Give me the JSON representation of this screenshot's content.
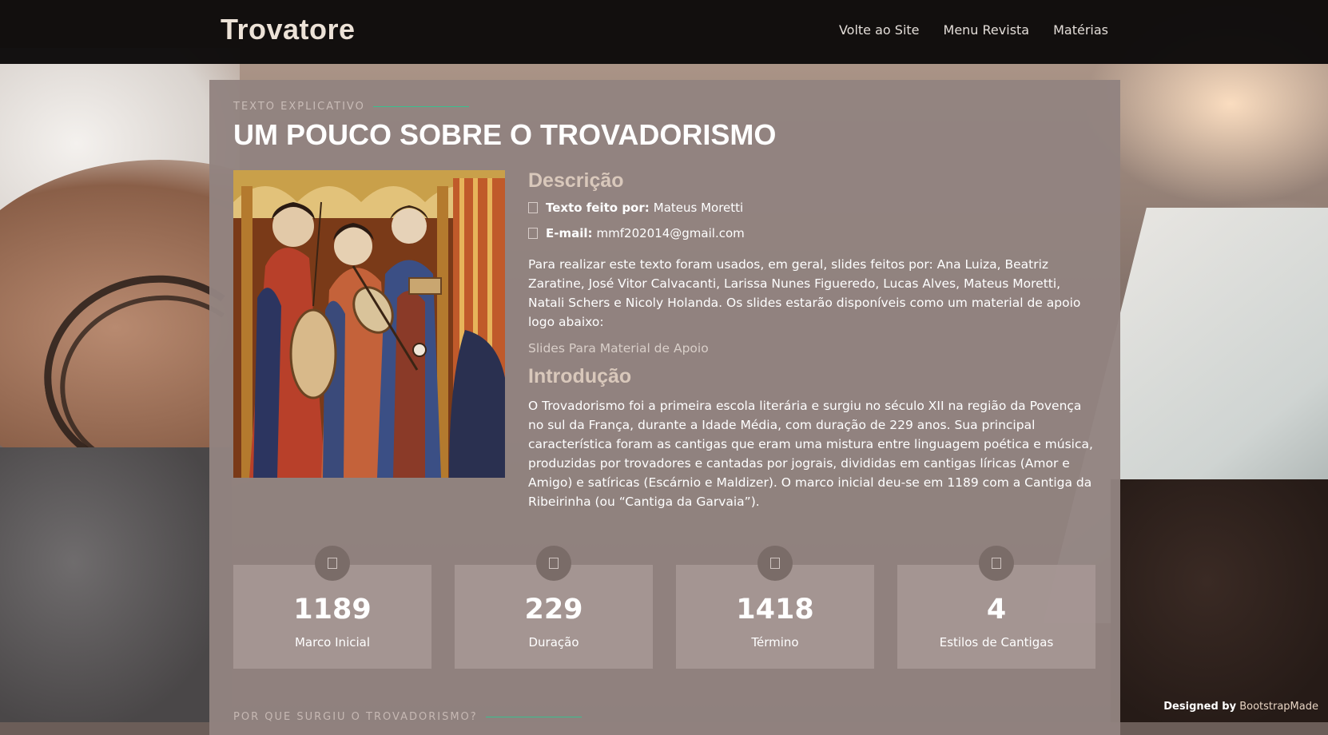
{
  "header": {
    "logo": "Trovatore",
    "nav": [
      "Volte ao Site",
      "Menu Revista",
      "Matérias"
    ]
  },
  "section": {
    "tag": "TEXTO EXPLICATIVO",
    "title": "UM POUCO SOBRE O TROVADORISMO"
  },
  "description": {
    "heading": "Descrição",
    "author_label": "Texto feito por:",
    "author_value": "Mateus Moretti",
    "email_label": "E-mail:",
    "email_value": "mmf202014@gmail.com",
    "paragraph": "Para realizar este texto foram usados, em geral, slides feitos por: Ana Luiza, Beatriz Zaratine, José Vitor Calvacanti, Larissa Nunes Figueredo, Lucas Alves, Mateus Moretti, Natali Schers e Nicoly Holanda. Os slides estarão disponíveis como um material de apoio logo abaixo:",
    "link": "Slides Para Material de Apoio"
  },
  "intro": {
    "heading": "Introdução",
    "paragraph": "O Trovadorismo foi a primeira escola literária e surgiu no século XII na região da Povença no sul da França, durante a Idade Média, com duração de 229 anos. Sua principal característica foram as cantigas que eram uma mistura entre linguagem poética e música, produzidas por trovadores e cantadas por jograis, divididas em cantigas líricas (Amor e Amigo) e satíricas (Escárnio e Maldizer). O marco inicial deu-se em 1189 com a Cantiga da Ribeirinha (ou “Cantiga da Garvaia”)."
  },
  "stats": [
    {
      "value": "1189",
      "label": "Marco Inicial"
    },
    {
      "value": "229",
      "label": "Duração"
    },
    {
      "value": "1418",
      "label": "Término"
    },
    {
      "value": "4",
      "label": "Estilos de Cantigas"
    }
  ],
  "next_section": {
    "tag": "POR QUE SURGIU O TROVADORISMO?"
  },
  "footer": {
    "designed_by": "Designed by",
    "brand": "BootstrapMade"
  },
  "icons": {
    "list_item": "checkbox-icon",
    "stat": "stat-icon",
    "image": "medieval-minstrels-painting"
  }
}
